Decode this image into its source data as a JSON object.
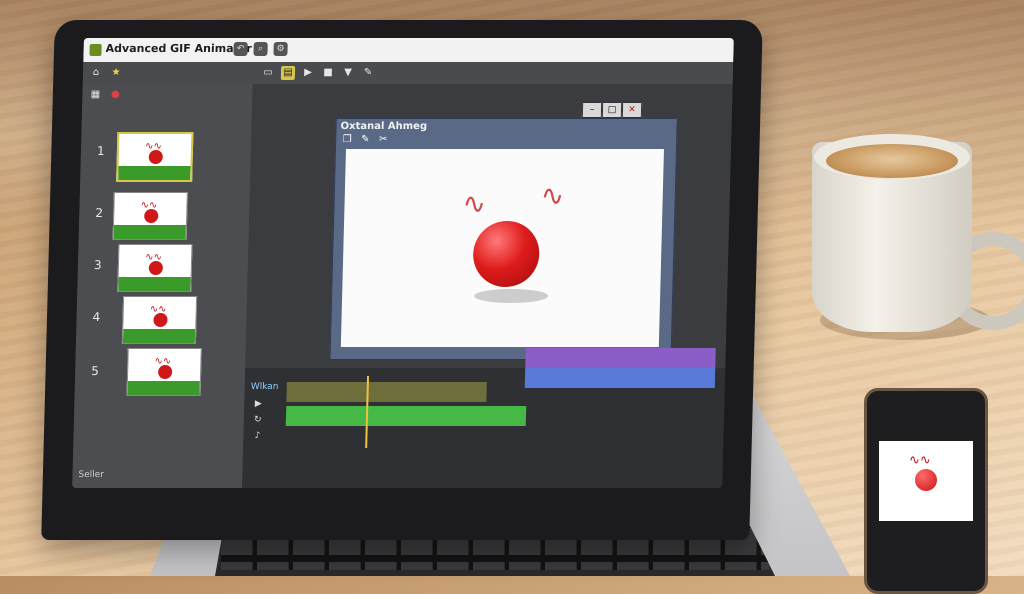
{
  "app": {
    "title": "Advanced GIF Animator",
    "canvas_window_title": "Oxtanal Ahmeg",
    "status_text": "Seller"
  },
  "frames": [
    {
      "number": "1",
      "selected": true
    },
    {
      "number": "2",
      "selected": false
    },
    {
      "number": "3",
      "selected": false
    },
    {
      "number": "4",
      "selected": false
    },
    {
      "number": "5",
      "selected": false
    }
  ],
  "timeline": {
    "label": "Wlkan"
  },
  "colors": {
    "accent_selection": "#d6c64a",
    "ball_red": "#d01818",
    "grass_green": "#3a9a2a",
    "track_green": "#45b845",
    "track_purple": "#8a5dc8",
    "track_blue": "#5a7ad8"
  },
  "icons": {
    "toolbar": [
      "home-icon",
      "folder-icon",
      "save-icon",
      "play-icon",
      "stop-icon",
      "zoom-icon",
      "settings-icon"
    ],
    "canvas_controls": [
      "minimize-icon",
      "maximize-icon",
      "close-icon"
    ]
  }
}
